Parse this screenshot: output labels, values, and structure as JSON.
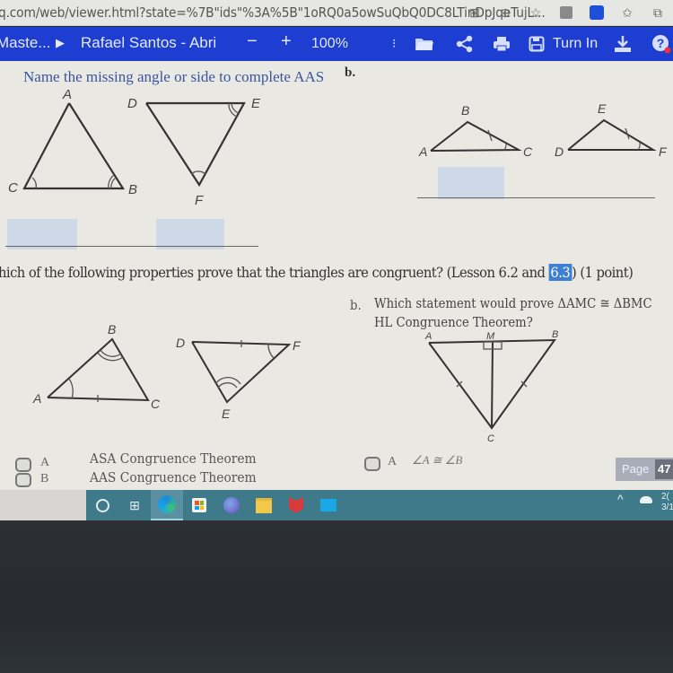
{
  "browser": {
    "url": "q.com/web/viewer.html?state=%7B\"ids\"%3A%5B\"1oRQ0a5owSuQbQ0DC8LTinDpJqeTujL...",
    "icons": [
      "reader-mode-icon",
      "zoom-icon",
      "favorites-add-icon",
      "extension-icon",
      "extension-blue-icon",
      "favorites-icon"
    ]
  },
  "toolbar": {
    "breadcrumb_parent": "Maste...",
    "document_title": "Rafael Santos - Abri",
    "zoom_out_label": "−",
    "zoom_in_label": "+",
    "zoom_level": "100%",
    "turn_in_label": "Turn In",
    "accent_color": "#1e3ed1"
  },
  "question1": {
    "instruction": "Name the missing angle or side to complete AAS",
    "part_b_label": "b.",
    "figure_a": {
      "triangle1_vertices": [
        "A",
        "C",
        "B"
      ],
      "triangle2_vertices": [
        "D",
        "E",
        "F"
      ]
    },
    "figure_b": {
      "triangle1_vertices": [
        "B",
        "A",
        "C"
      ],
      "triangle2_vertices": [
        "E",
        "D",
        "F"
      ]
    }
  },
  "question2": {
    "prompt_start": "hich of the following properties prove that the triangles are congruent? (Lesson 6.2 and ",
    "prompt_highlight": "6.3",
    "prompt_end": ") (1 point)",
    "figure_a": {
      "triangle1_vertices": [
        "B",
        "A",
        "C"
      ],
      "triangle2_vertices": [
        "D",
        "F",
        "E"
      ]
    },
    "part_b": {
      "label": "b.",
      "line1": "Which statement would prove  ΔAMC ≅ ΔBMC",
      "line2": "HL Congruence Theorem?",
      "figure_vertices": [
        "A",
        "M",
        "B",
        "C"
      ]
    },
    "options_a": [
      {
        "letter": "A",
        "text": "ASA Congruence Theorem"
      },
      {
        "letter": "B",
        "text": "AAS Congruence Theorem"
      }
    ],
    "options_b": [
      {
        "letter": "A",
        "text": "∠A ≅ ∠B"
      }
    ]
  },
  "page_indicator": {
    "label": "Page",
    "value": "47"
  },
  "taskbar": {
    "icons": [
      "cortana-icon",
      "task-view-icon",
      "edge-icon",
      "store-icon",
      "browser-icon",
      "file-explorer-icon",
      "mcafee-icon",
      "mail-icon"
    ],
    "tray_time": "2(",
    "tray_date": "3/1"
  }
}
